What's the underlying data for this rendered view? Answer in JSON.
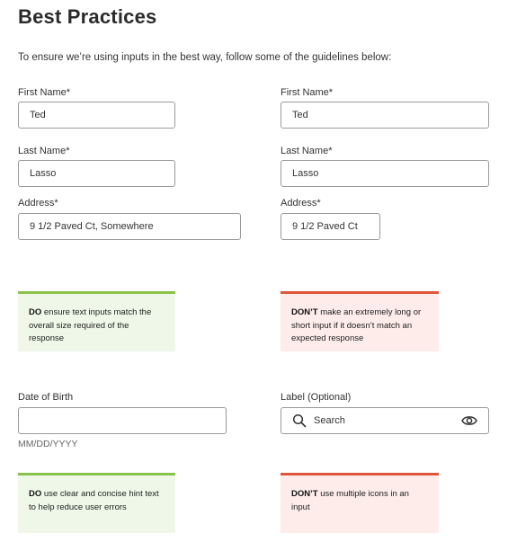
{
  "page": {
    "title": "Best Practices",
    "intro": "To ensure we’re using inputs in the best way, follow some of the guidelines below:"
  },
  "left_form": {
    "first_name_label": "First Name*",
    "first_name_value": "Ted",
    "last_name_label": "Last Name*",
    "last_name_value": "Lasso",
    "address_label": "Address*",
    "address_value": "9 1/2 Paved Ct, Somewhere"
  },
  "right_form": {
    "first_name_label": "First Name*",
    "first_name_value": "Ted",
    "last_name_label": "Last Name*",
    "last_name_value": "Lasso",
    "address_label": "Address*",
    "address_value": "9 1/2 Paved Ct"
  },
  "card1": {
    "lead": "DO",
    "text": " ensure text inputs match the overall size required of the response"
  },
  "card2": {
    "lead": "DON’T",
    "text": " make an extremely long or short input if it doesn’t match an expected response"
  },
  "dob": {
    "label": "Date of Birth",
    "value": "",
    "hint": "MM/DD/YYYY"
  },
  "search": {
    "label": "Label (Optional)",
    "placeholder": "Search",
    "search_icon": "search-icon",
    "eye_icon": "eye-icon"
  },
  "card3": {
    "lead": "DO",
    "text": " use clear and concise hint text to help reduce user errors"
  },
  "card4": {
    "lead": "DON’T",
    "text": " use multiple icons in an input"
  },
  "colors": {
    "do_accent": "#8bc34a",
    "do_bg": "#eef7e8",
    "dont_accent": "#e0563b",
    "dont_bg": "#fdecea",
    "input_border": "#9a9a9a"
  }
}
